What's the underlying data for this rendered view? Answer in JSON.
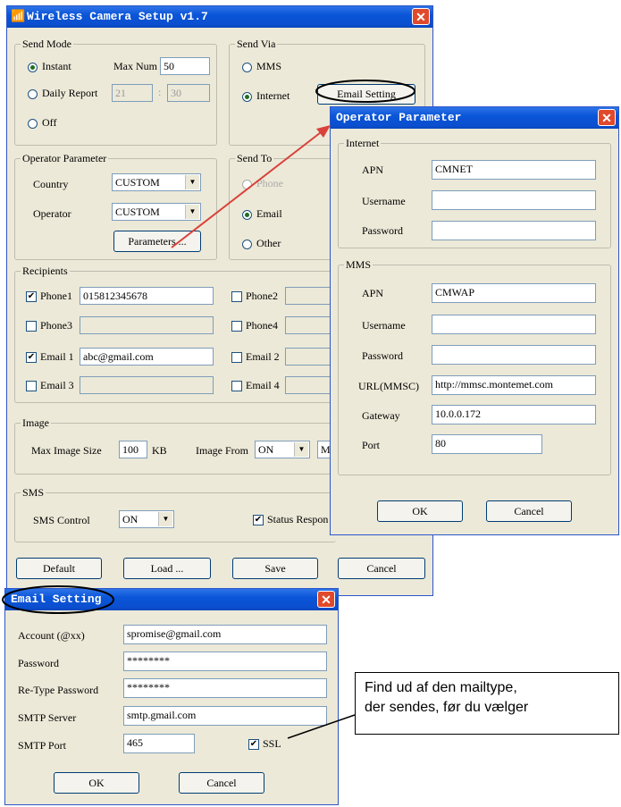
{
  "main": {
    "title": "Wireless Camera Setup  v1.7",
    "send_mode": {
      "legend": "Send Mode",
      "instant": "Instant",
      "max_num_label": "Max Num",
      "max_num_value": "50",
      "daily_report": "Daily Report",
      "daily_hour": "21",
      "daily_sep": ":",
      "daily_min": "30",
      "off": "Off"
    },
    "send_via": {
      "legend": "Send Via",
      "mms": "MMS",
      "internet": "Internet",
      "email_setting_button": "Email Setting"
    },
    "operator": {
      "legend": "Operator Parameter",
      "country_label": "Country",
      "country_value": "CUSTOM",
      "operator_label": "Operator",
      "operator_value": "CUSTOM",
      "parameters_button": "Parameters ..."
    },
    "send_to": {
      "legend": "Send To",
      "phone": "Phone",
      "email": "Email",
      "other": "Other"
    },
    "recipients": {
      "legend": "Recipients",
      "phone1": "Phone1",
      "phone1_value": "015812345678",
      "phone2": "Phone2",
      "phone3": "Phone3",
      "phone4": "Phone4",
      "email1": "Email 1",
      "email1_value": "abc@gmail.com",
      "email2": "Email 2",
      "email3": "Email 3",
      "email4": "Email 4"
    },
    "image": {
      "legend": "Image",
      "max_size_label": "Max Image Size",
      "max_size_value": "100",
      "kb": "KB",
      "image_from_label": "Image From",
      "image_from_value": "ON",
      "mi_value": "Mi"
    },
    "sms": {
      "legend": "SMS",
      "control_label": "SMS Control",
      "control_value": "ON",
      "status_label": "Status Respon"
    },
    "buttons": {
      "default": "Default",
      "load": "Load ...",
      "save": "Save",
      "cancel": "Cancel"
    }
  },
  "operator_dialog": {
    "title": "Operator Parameter",
    "internet": {
      "legend": "Internet",
      "apn_label": "APN",
      "apn_value": "CMNET",
      "username_label": "Username",
      "password_label": "Password"
    },
    "mms": {
      "legend": "MMS",
      "apn_label": "APN",
      "apn_value": "CMWAP",
      "username_label": "Username",
      "password_label": "Password",
      "url_label": "URL(MMSC)",
      "url_value": "http://mmsc.montemet.com",
      "gateway_label": "Gateway",
      "gateway_value": "10.0.0.172",
      "port_label": "Port",
      "port_value": "80"
    },
    "ok": "OK",
    "cancel": "Cancel"
  },
  "email_dialog": {
    "title": "Email Setting",
    "account_label": "Account (@xx)",
    "account_value": "spromise@gmail.com",
    "password_label": "Password",
    "password_value": "********",
    "retype_label": "Re-Type Password",
    "retype_value": "********",
    "smtp_server_label": "SMTP Server",
    "smtp_server_value": "smtp.gmail.com",
    "smtp_port_label": "SMTP Port",
    "smtp_port_value": "465",
    "ssl_label": "SSL",
    "ok": "OK",
    "cancel": "Cancel"
  },
  "callout": {
    "line1": "Find ud af den mailtype,",
    "line2": "der sendes, før du vælger"
  },
  "colors": {
    "titlebar": "#0a55d8",
    "annotation_arrow": "#d9413a",
    "window_bg": "#ece9d8"
  }
}
